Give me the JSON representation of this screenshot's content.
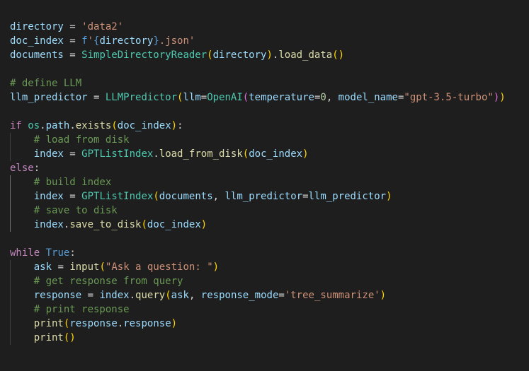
{
  "editor": {
    "theme_background": "#1e1e1e",
    "lines": [
      {
        "indent": 0,
        "tokens": [
          {
            "t": "directory",
            "c": "var"
          },
          {
            "t": " = ",
            "c": "op"
          },
          {
            "t": "'data2'",
            "c": "str"
          }
        ]
      },
      {
        "indent": 0,
        "tokens": [
          {
            "t": "doc_index",
            "c": "var"
          },
          {
            "t": " = ",
            "c": "op"
          },
          {
            "t": "f",
            "c": "const"
          },
          {
            "t": "'",
            "c": "str"
          },
          {
            "t": "{",
            "c": "const"
          },
          {
            "t": "directory",
            "c": "var"
          },
          {
            "t": "}",
            "c": "const"
          },
          {
            "t": ".json'",
            "c": "str"
          }
        ]
      },
      {
        "indent": 0,
        "tokens": [
          {
            "t": "documents",
            "c": "var"
          },
          {
            "t": " = ",
            "c": "op"
          },
          {
            "t": "SimpleDirectoryReader",
            "c": "cls"
          },
          {
            "t": "(",
            "c": "b1"
          },
          {
            "t": "directory",
            "c": "var"
          },
          {
            "t": ")",
            "c": "b1"
          },
          {
            "t": ".",
            "c": "op"
          },
          {
            "t": "load_data",
            "c": "fn"
          },
          {
            "t": "()",
            "c": "b1"
          }
        ]
      },
      {
        "indent": 0,
        "tokens": []
      },
      {
        "indent": 0,
        "tokens": [
          {
            "t": "# define LLM",
            "c": "com"
          }
        ]
      },
      {
        "indent": 0,
        "tokens": [
          {
            "t": "llm_predictor",
            "c": "var"
          },
          {
            "t": " = ",
            "c": "op"
          },
          {
            "t": "LLMPredictor",
            "c": "cls"
          },
          {
            "t": "(",
            "c": "b1"
          },
          {
            "t": "llm",
            "c": "var"
          },
          {
            "t": "=",
            "c": "op"
          },
          {
            "t": "OpenAI",
            "c": "cls"
          },
          {
            "t": "(",
            "c": "b2"
          },
          {
            "t": "temperature",
            "c": "var"
          },
          {
            "t": "=",
            "c": "op"
          },
          {
            "t": "0",
            "c": "num"
          },
          {
            "t": ", ",
            "c": "op"
          },
          {
            "t": "model_name",
            "c": "var"
          },
          {
            "t": "=",
            "c": "op"
          },
          {
            "t": "\"gpt-3.5-turbo\"",
            "c": "str"
          },
          {
            "t": ")",
            "c": "b2"
          },
          {
            "t": ")",
            "c": "b1"
          }
        ]
      },
      {
        "indent": 0,
        "tokens": []
      },
      {
        "indent": 0,
        "tokens": [
          {
            "t": "if",
            "c": "kw"
          },
          {
            "t": " ",
            "c": "op"
          },
          {
            "t": "os",
            "c": "cls"
          },
          {
            "t": ".",
            "c": "op"
          },
          {
            "t": "path",
            "c": "var"
          },
          {
            "t": ".",
            "c": "op"
          },
          {
            "t": "exists",
            "c": "fn"
          },
          {
            "t": "(",
            "c": "b1"
          },
          {
            "t": "doc_index",
            "c": "var"
          },
          {
            "t": ")",
            "c": "b1"
          },
          {
            "t": ":",
            "c": "op"
          }
        ]
      },
      {
        "indent": 1,
        "tokens": [
          {
            "t": "    ",
            "c": "op"
          },
          {
            "t": "# load from disk",
            "c": "com"
          }
        ]
      },
      {
        "indent": 1,
        "tokens": [
          {
            "t": "    ",
            "c": "op"
          },
          {
            "t": "index",
            "c": "var"
          },
          {
            "t": " = ",
            "c": "op"
          },
          {
            "t": "GPTListIndex",
            "c": "cls"
          },
          {
            "t": ".",
            "c": "op"
          },
          {
            "t": "load_from_disk",
            "c": "fn"
          },
          {
            "t": "(",
            "c": "b1"
          },
          {
            "t": "doc_index",
            "c": "var"
          },
          {
            "t": ")",
            "c": "b1"
          }
        ]
      },
      {
        "indent": 0,
        "tokens": [
          {
            "t": "else",
            "c": "kw"
          },
          {
            "t": ":",
            "c": "op"
          }
        ]
      },
      {
        "indent": 1,
        "active": true,
        "tokens": [
          {
            "t": "    ",
            "c": "op"
          },
          {
            "t": "# build index",
            "c": "com"
          }
        ]
      },
      {
        "indent": 1,
        "active": true,
        "tokens": [
          {
            "t": "    ",
            "c": "op"
          },
          {
            "t": "index",
            "c": "var"
          },
          {
            "t": " = ",
            "c": "op"
          },
          {
            "t": "GPTListIndex",
            "c": "cls"
          },
          {
            "t": "(",
            "c": "b1"
          },
          {
            "t": "documents",
            "c": "var"
          },
          {
            "t": ", ",
            "c": "op"
          },
          {
            "t": "llm_predictor",
            "c": "var"
          },
          {
            "t": "=",
            "c": "op"
          },
          {
            "t": "llm_predictor",
            "c": "var"
          },
          {
            "t": ")",
            "c": "b1"
          }
        ]
      },
      {
        "indent": 1,
        "active": true,
        "tokens": [
          {
            "t": "    ",
            "c": "op"
          },
          {
            "t": "# save to disk",
            "c": "com"
          }
        ]
      },
      {
        "indent": 1,
        "active": true,
        "tokens": [
          {
            "t": "    ",
            "c": "op"
          },
          {
            "t": "index",
            "c": "var"
          },
          {
            "t": ".",
            "c": "op"
          },
          {
            "t": "save_to_disk",
            "c": "fn"
          },
          {
            "t": "(",
            "c": "b1"
          },
          {
            "t": "doc_index",
            "c": "var"
          },
          {
            "t": ")",
            "c": "b1"
          }
        ]
      },
      {
        "indent": 0,
        "tokens": []
      },
      {
        "indent": 0,
        "tokens": [
          {
            "t": "while",
            "c": "kw"
          },
          {
            "t": " ",
            "c": "op"
          },
          {
            "t": "True",
            "c": "const"
          },
          {
            "t": ":",
            "c": "op"
          }
        ]
      },
      {
        "indent": 1,
        "tokens": [
          {
            "t": "    ",
            "c": "op"
          },
          {
            "t": "ask",
            "c": "var"
          },
          {
            "t": " = ",
            "c": "op"
          },
          {
            "t": "input",
            "c": "fn"
          },
          {
            "t": "(",
            "c": "b1"
          },
          {
            "t": "\"Ask a question: \"",
            "c": "str"
          },
          {
            "t": ")",
            "c": "b1"
          }
        ]
      },
      {
        "indent": 1,
        "tokens": [
          {
            "t": "    ",
            "c": "op"
          },
          {
            "t": "# get response from query",
            "c": "com"
          }
        ]
      },
      {
        "indent": 1,
        "tokens": [
          {
            "t": "    ",
            "c": "op"
          },
          {
            "t": "response",
            "c": "var"
          },
          {
            "t": " = ",
            "c": "op"
          },
          {
            "t": "index",
            "c": "var"
          },
          {
            "t": ".",
            "c": "op"
          },
          {
            "t": "query",
            "c": "fn"
          },
          {
            "t": "(",
            "c": "b1"
          },
          {
            "t": "ask",
            "c": "var"
          },
          {
            "t": ", ",
            "c": "op"
          },
          {
            "t": "response_mode",
            "c": "var"
          },
          {
            "t": "=",
            "c": "op"
          },
          {
            "t": "'tree_summarize'",
            "c": "str"
          },
          {
            "t": ")",
            "c": "b1"
          }
        ]
      },
      {
        "indent": 1,
        "tokens": [
          {
            "t": "    ",
            "c": "op"
          },
          {
            "t": "# print response",
            "c": "com"
          }
        ]
      },
      {
        "indent": 1,
        "tokens": [
          {
            "t": "    ",
            "c": "op"
          },
          {
            "t": "print",
            "c": "fn"
          },
          {
            "t": "(",
            "c": "b1"
          },
          {
            "t": "response",
            "c": "var"
          },
          {
            "t": ".",
            "c": "op"
          },
          {
            "t": "response",
            "c": "var"
          },
          {
            "t": ")",
            "c": "b1"
          }
        ]
      },
      {
        "indent": 1,
        "tokens": [
          {
            "t": "    ",
            "c": "op"
          },
          {
            "t": "print",
            "c": "fn"
          },
          {
            "t": "()",
            "c": "b1"
          }
        ]
      }
    ]
  }
}
